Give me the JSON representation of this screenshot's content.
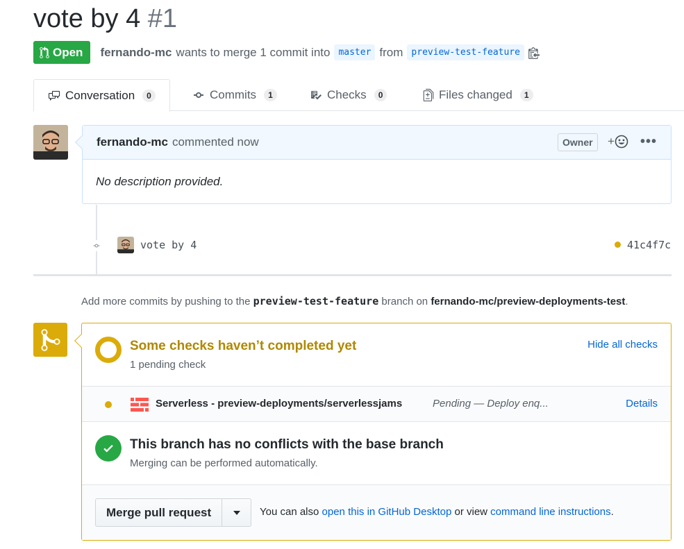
{
  "pr": {
    "title": "vote by 4",
    "number": "#1",
    "state": "Open",
    "author": "fernando-mc",
    "merge_text": "wants to merge 1 commit into",
    "base_branch": "master",
    "from_text": "from",
    "head_branch": "preview-test-feature"
  },
  "tabs": [
    {
      "label": "Conversation",
      "count": "0",
      "icon": "comment-discussion-icon"
    },
    {
      "label": "Commits",
      "count": "1",
      "icon": "git-commit-icon"
    },
    {
      "label": "Checks",
      "count": "0",
      "icon": "checklist-icon"
    },
    {
      "label": "Files changed",
      "count": "1",
      "icon": "file-diff-icon"
    }
  ],
  "comment": {
    "author": "fernando-mc",
    "action": "commented now",
    "owner_badge": "Owner",
    "react_label": "+",
    "more_label": "•••",
    "body": "No description provided."
  },
  "commit": {
    "message": "vote by 4",
    "sha": "41c4f7c"
  },
  "push_note": {
    "prefix": "Add more commits by pushing to the",
    "branch": "preview-test-feature",
    "middle": "branch on",
    "repo": "fernando-mc/preview-deployments-test",
    "suffix": "."
  },
  "checks": {
    "heading": "Some checks haven’t completed yet",
    "sub": "1 pending check",
    "hide_label": "Hide all checks",
    "items": [
      {
        "name": "Serverless - preview-deployments/serverlessjams",
        "status": "Pending — Deploy enq...",
        "details": "Details"
      }
    ]
  },
  "conflicts": {
    "heading": "This branch has no conflicts with the base branch",
    "sub": "Merging can be performed automatically."
  },
  "merge": {
    "button_label": "Merge pull request",
    "note_prefix": "You can also",
    "desktop_link": "open this in GitHub Desktop",
    "note_middle": "or view",
    "cli_link": "command line instructions",
    "note_suffix": "."
  },
  "colors": {
    "open_green": "#28a745",
    "pending_yellow": "#dbab09",
    "link_blue": "#0366d6"
  }
}
